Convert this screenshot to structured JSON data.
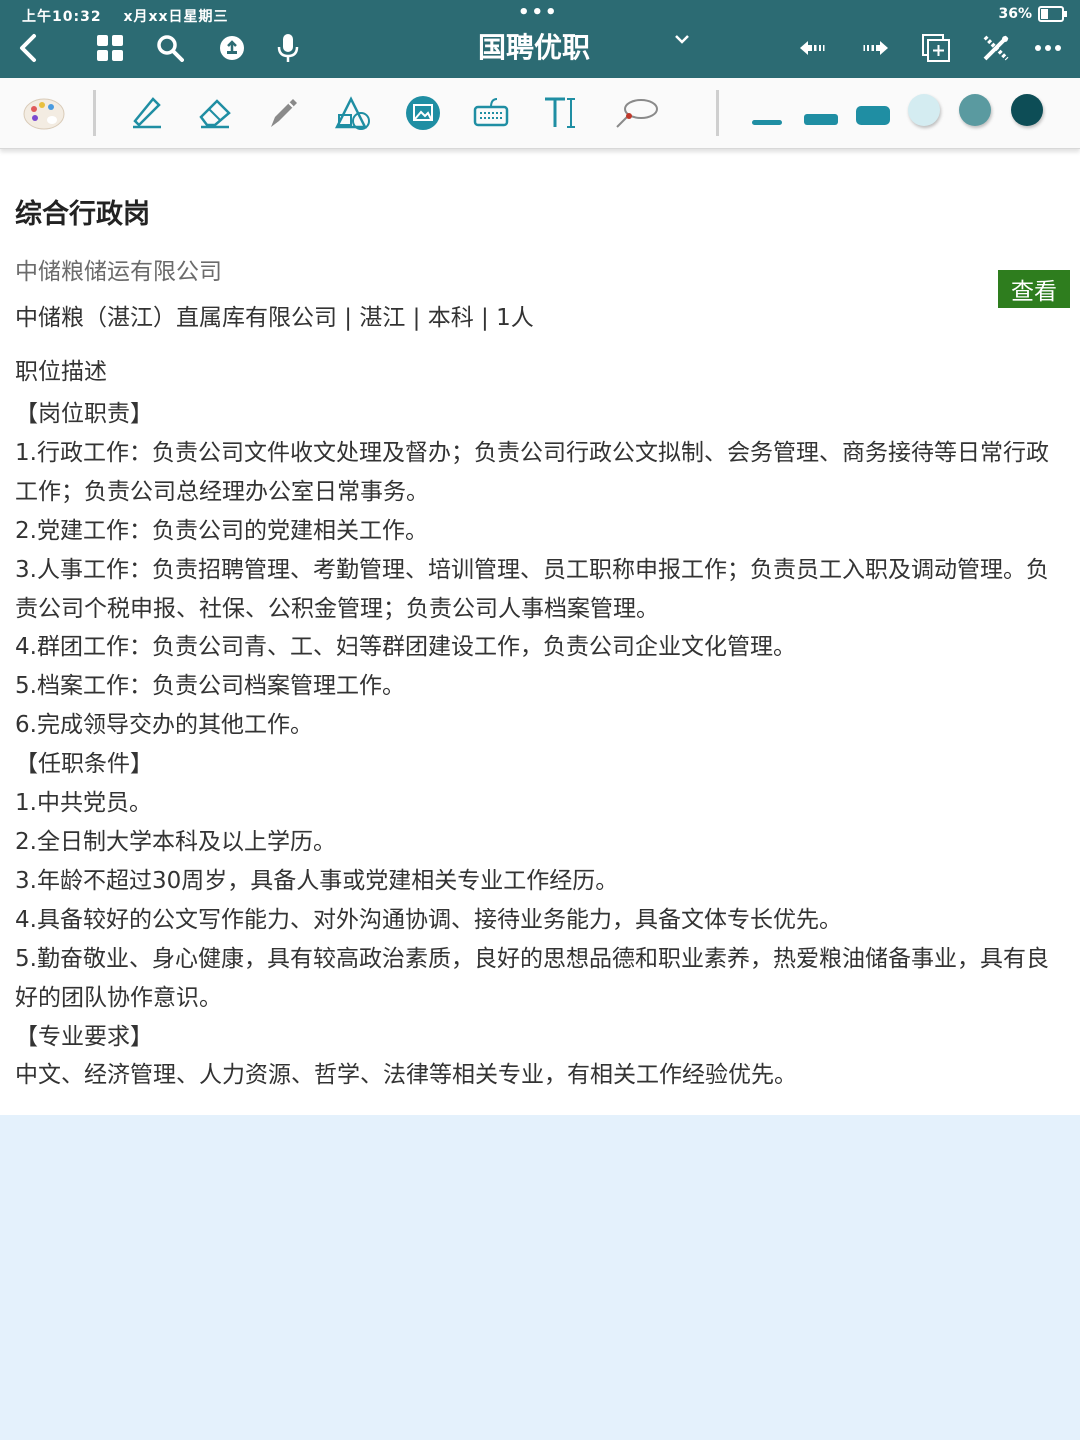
{
  "status": {
    "time": "上午10:32",
    "date": "x月xx日星期三",
    "battery": "36%"
  },
  "topbar": {
    "title": "国聘优职"
  },
  "toolbar": {
    "colors": [
      "#d4ecf1",
      "#5a9aa0",
      "#0d4d56"
    ]
  },
  "job": {
    "title": "综合行政岗",
    "company": "中储粮储运有限公司",
    "info": "中储粮（湛江）直属库有限公司 | 湛江 | 本科 | 1人",
    "view_button": "查看",
    "desc_label": "职位描述",
    "desc_lines": [
      "【岗位职责】",
      "1.行政工作：负责公司文件收文处理及督办；负责公司行政公文拟制、会务管理、商务接待等日常行政工作；负责公司总经理办公室日常事务。",
      "2.党建工作：负责公司的党建相关工作。",
      "3.人事工作：负责招聘管理、考勤管理、培训管理、员工职称申报工作；负责员工入职及调动管理。负责公司个税申报、社保、公积金管理；负责公司人事档案管理。",
      "4.群团工作：负责公司青、工、妇等群团建设工作，负责公司企业文化管理。",
      "5.档案工作：负责公司档案管理工作。",
      "6.完成领导交办的其他工作。",
      "【任职条件】",
      "1.中共党员。",
      "2.全日制大学本科及以上学历。",
      "3.年龄不超过30周岁，具备人事或党建相关专业工作经历。",
      "4.具备较好的公文写作能力、对外沟通协调、接待业务能力，具备文体专长优先。",
      "5.勤奋敬业、身心健康，具有较高政治素质，良好的思想品德和职业素养，热爱粮油储备事业，具有良好的团队协作意识。",
      "【专业要求】",
      "中文、经济管理、人力资源、哲学、法律等相关专业，有相关工作经验优先。"
    ]
  }
}
